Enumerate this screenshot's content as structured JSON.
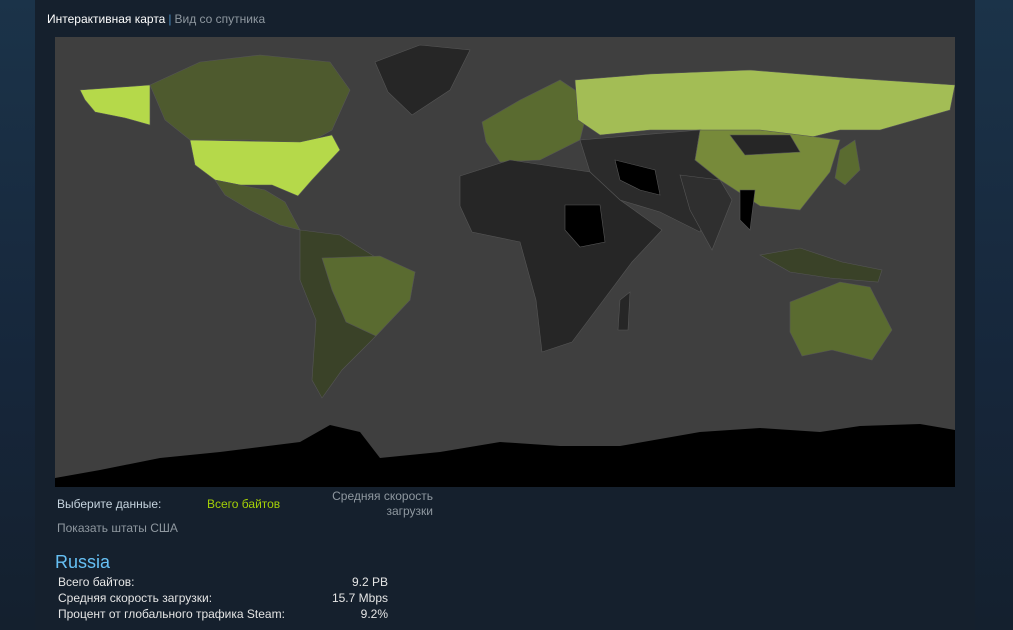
{
  "header": {
    "active_tab": "Интерактивная карта",
    "separator": "|",
    "other_tab": "Вид со спутника"
  },
  "controls": {
    "select_label": "Выберите данные:",
    "option_total": "Всего байтов",
    "option_speed_line1": "Средняя скорость",
    "option_speed_line2": "загрузки",
    "show_states": "Показать штаты США"
  },
  "selected_country": {
    "name": "Russia",
    "stats": [
      {
        "label": "Всего байтов:",
        "value": "9.2 PB"
      },
      {
        "label": "Средняя скорость загрузки:",
        "value": "15.7 Mbps"
      },
      {
        "label": "Процент от глобального трафика Steam:",
        "value": "9.2%"
      }
    ]
  },
  "colors": {
    "ocean": "#3f3f3f",
    "highest": "#b5d94a",
    "high": "#a3bd55",
    "mid": "#778a3a",
    "low": "#4e5a2e",
    "lowest": "#262626",
    "none": "#000000",
    "selected_option": "#a4d007"
  }
}
